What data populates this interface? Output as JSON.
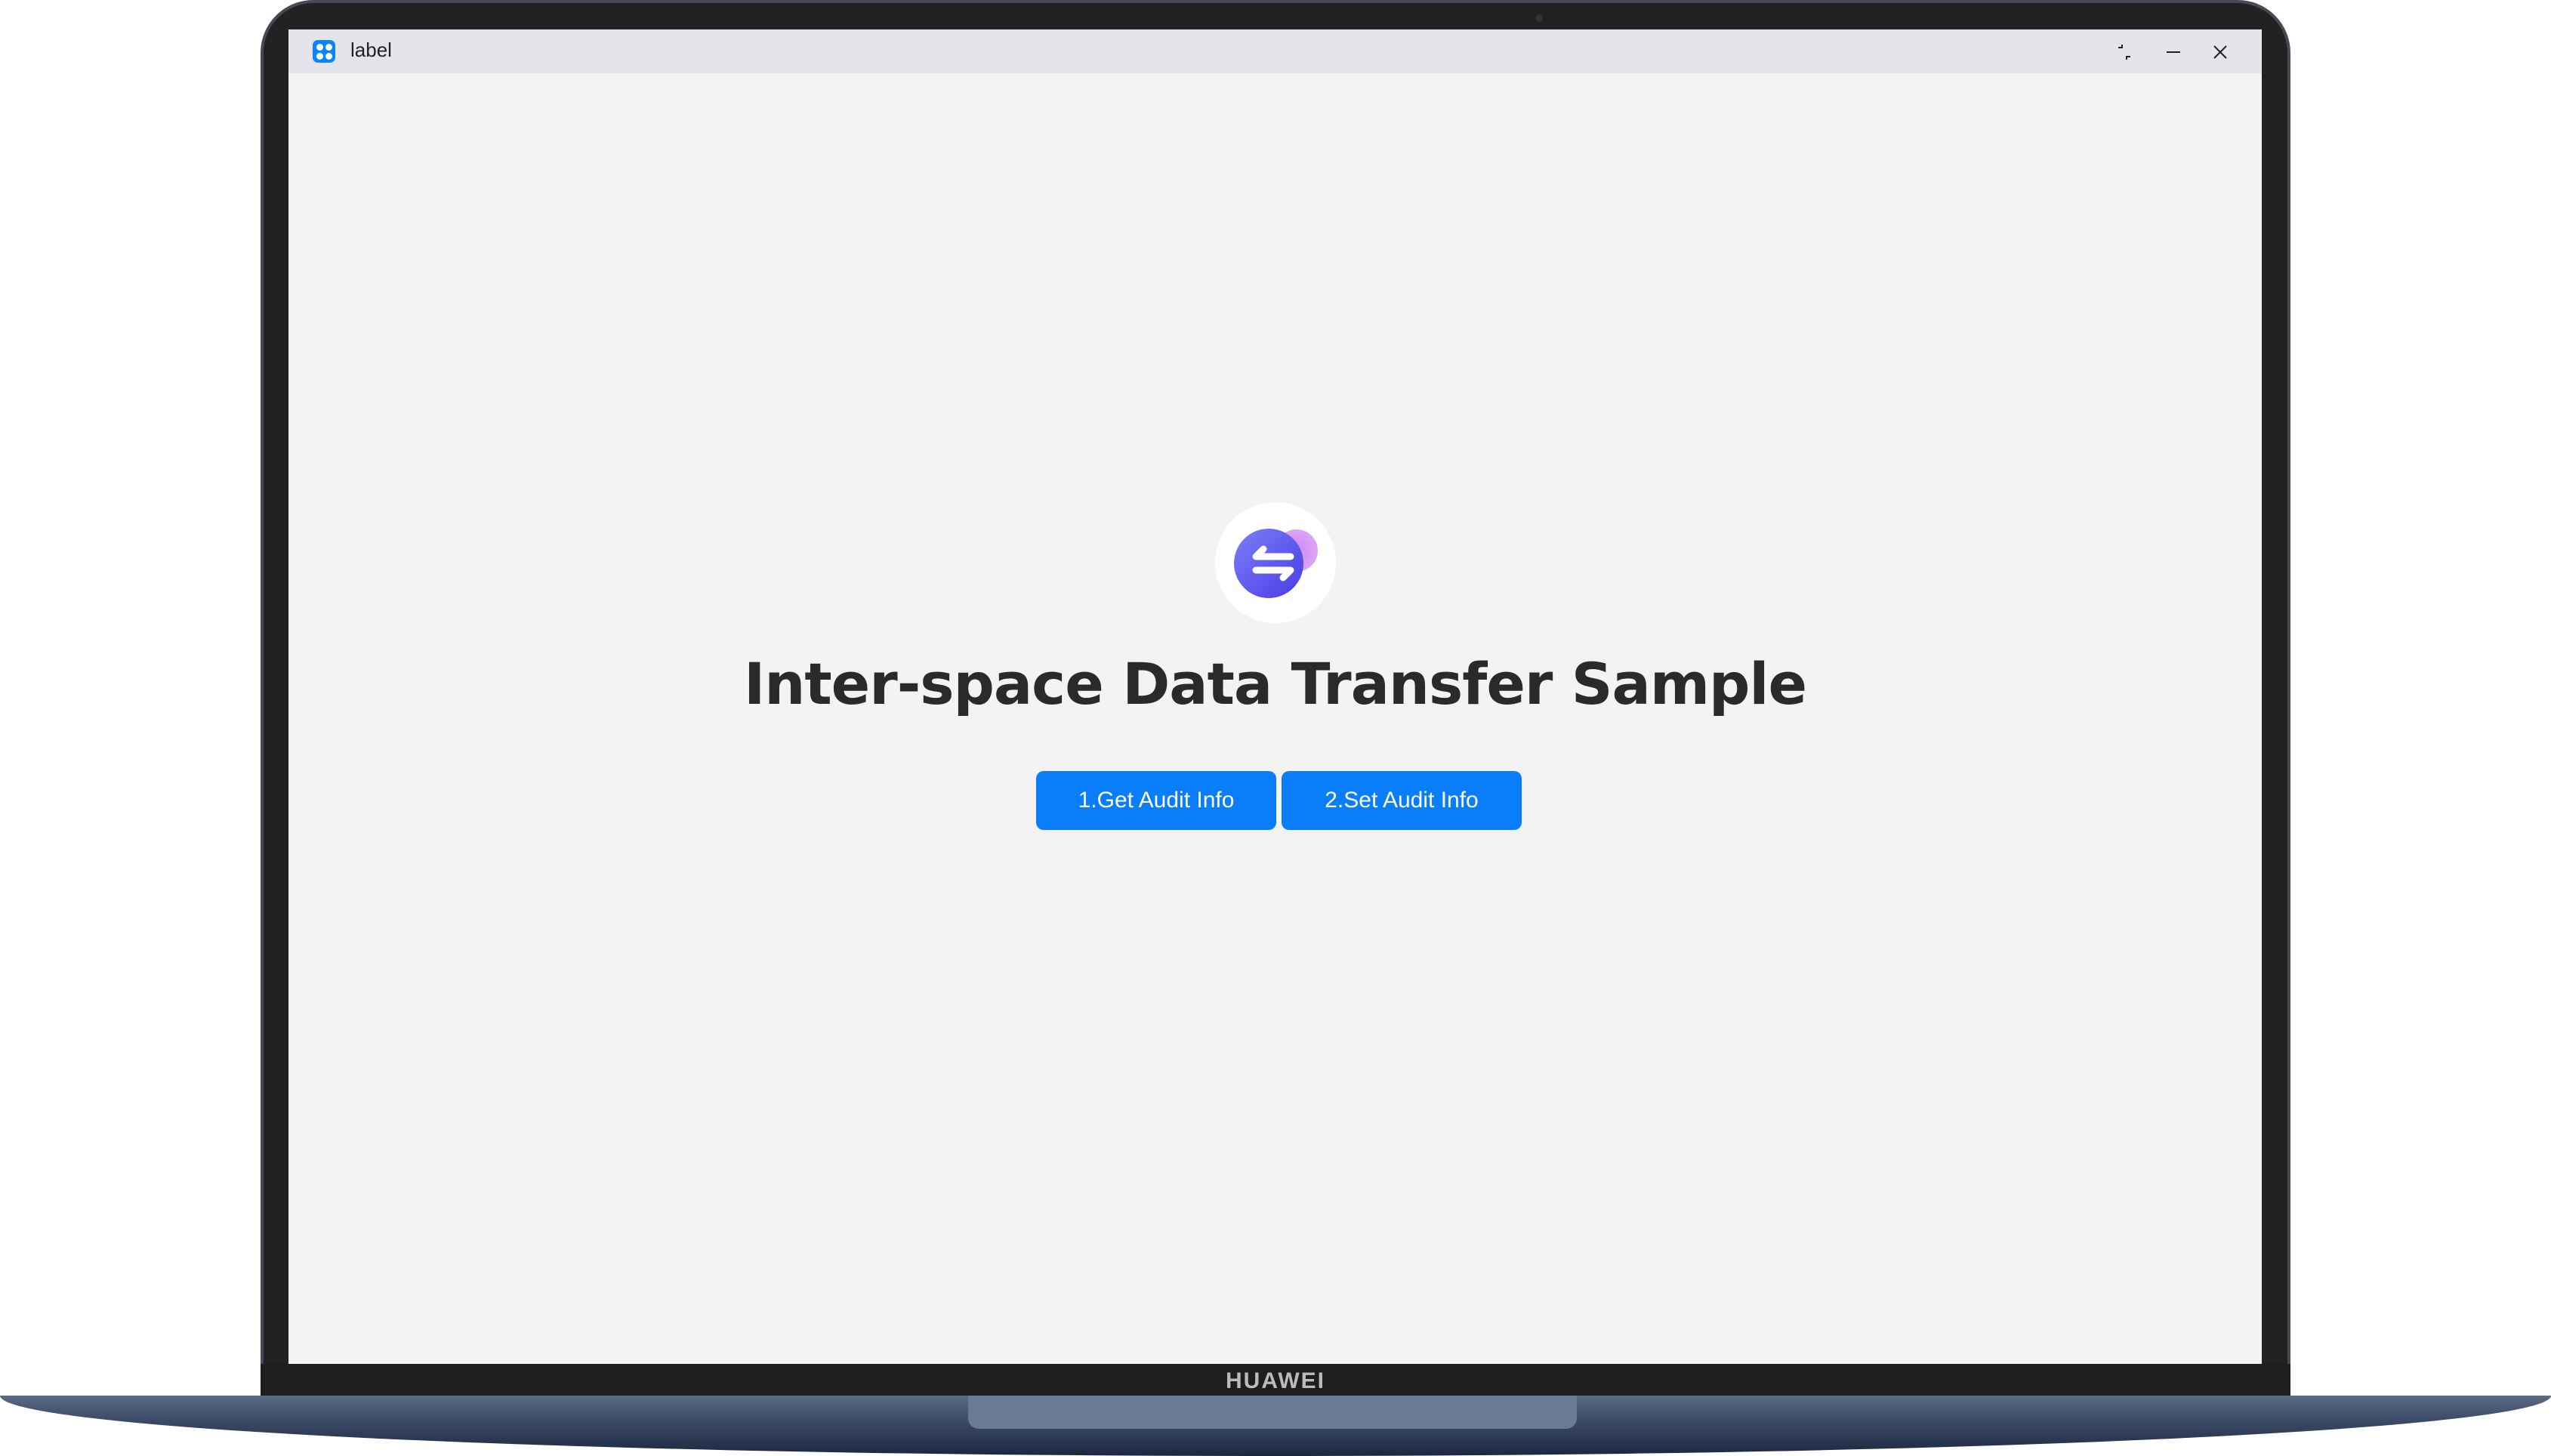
{
  "window": {
    "title": "label",
    "app_icon": "app-grid-icon",
    "controls": [
      "restore-icon",
      "minimize-icon",
      "close-icon"
    ]
  },
  "main": {
    "logo_icon": "transfer-arrows-icon",
    "headline": "Inter-space Data Transfer Sample",
    "buttons": [
      {
        "label": "1.Get Audit Info"
      },
      {
        "label": "2.Set Audit Info"
      }
    ]
  },
  "device": {
    "brand": "HUAWEI"
  },
  "colors": {
    "accent": "#0a7dfb",
    "logo_primary": "#5a4ef0",
    "logo_secondary": "#c07cf0",
    "background": "#f3f3f4"
  }
}
